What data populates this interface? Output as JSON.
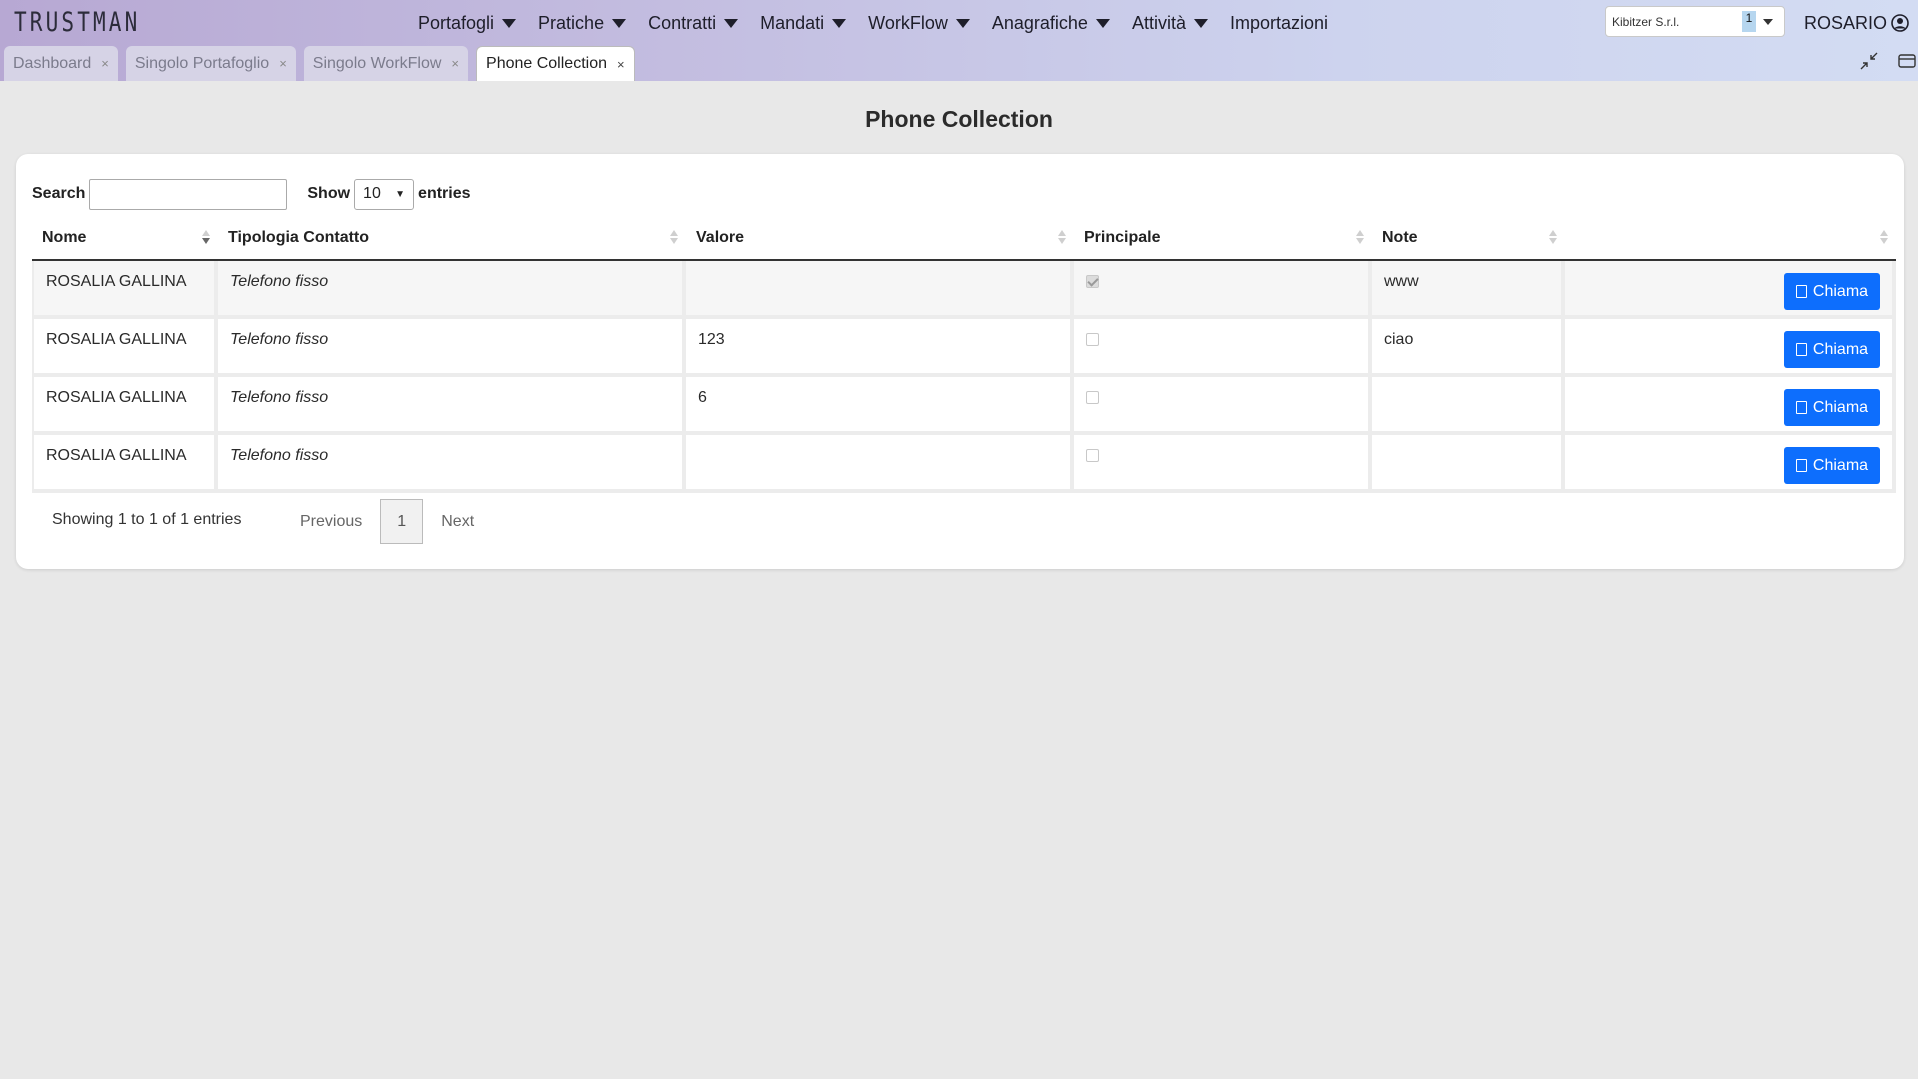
{
  "app": {
    "logo": "TRUSTMAN"
  },
  "nav": {
    "items": [
      {
        "label": "Portafogli",
        "dropdown": true
      },
      {
        "label": "Pratiche",
        "dropdown": true
      },
      {
        "label": "Contratti",
        "dropdown": true
      },
      {
        "label": "Mandati",
        "dropdown": true
      },
      {
        "label": "WorkFlow",
        "dropdown": true
      },
      {
        "label": "Anagrafiche",
        "dropdown": true
      },
      {
        "label": "Attività",
        "dropdown": true
      },
      {
        "label": "Importazioni",
        "dropdown": false
      }
    ],
    "company": {
      "value": "Kibitzer S.r.l.",
      "count": "1"
    },
    "user": {
      "name": "ROSARIO",
      "icon": "user-circle-icon"
    }
  },
  "tabs": [
    {
      "label": "Dashboard",
      "close": "×",
      "active": false
    },
    {
      "label": "Singolo Portafoglio",
      "close": "×",
      "active": false
    },
    {
      "label": "Singolo WorkFlow",
      "close": "×",
      "active": false
    },
    {
      "label": "Phone Collection",
      "close": "×",
      "active": true
    }
  ],
  "page": {
    "title": "Phone Collection"
  },
  "controls": {
    "search_label": "Search",
    "search_value": "",
    "show_label": "Show",
    "show_value": "10",
    "entries_label": "entries"
  },
  "table": {
    "columns": [
      "Nome",
      "Tipologia Contatto",
      "Valore",
      "Principale",
      "Note",
      ""
    ],
    "sorted_column": "Nome",
    "rows": [
      {
        "nome": "ROSALIA GALLINA",
        "tipologia": "Telefono fisso",
        "valore": "",
        "principale": true,
        "note": "www",
        "action": "Chiama"
      },
      {
        "nome": "ROSALIA GALLINA",
        "tipologia": "Telefono fisso",
        "valore": "123",
        "principale": false,
        "note": "ciao",
        "action": "Chiama"
      },
      {
        "nome": "ROSALIA GALLINA",
        "tipologia": "Telefono fisso",
        "valore": "6",
        "principale": false,
        "note": "",
        "action": "Chiama"
      },
      {
        "nome": "ROSALIA GALLINA",
        "tipologia": "Telefono fisso",
        "valore": "",
        "principale": false,
        "note": "",
        "action": "Chiama"
      }
    ]
  },
  "footer": {
    "info": "Showing 1 to 1 of 1 entries",
    "previous": "Previous",
    "current_page": "1",
    "next": "Next"
  },
  "colors": {
    "primary": "#0d6efd",
    "page_bg": "#e8e8e8"
  }
}
